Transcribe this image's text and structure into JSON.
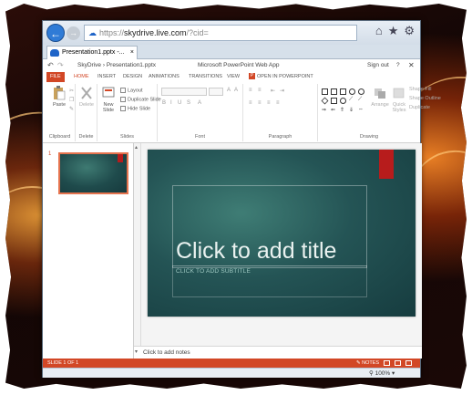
{
  "browser": {
    "address_scheme": "https://",
    "address_host": "skydrive.live.com",
    "address_rest": "/?cid=",
    "tab_title": "Presentation1.pptx -..."
  },
  "appbar": {
    "crumb_root": "SkyDrive",
    "crumb_sep": "›",
    "crumb_file": "Presentation1.pptx",
    "app_title": "Microsoft PowerPoint Web App",
    "sign_out": "Sign out",
    "help": "?",
    "close": "✕"
  },
  "ribbon_tabs": [
    "FILE",
    "HOME",
    "INSERT",
    "DESIGN",
    "ANIMATIONS",
    "TRANSITIONS",
    "VIEW",
    "OPEN IN POWERPOINT"
  ],
  "active_tab": "HOME",
  "ribbon": {
    "clipboard": {
      "paste": "Paste",
      "label": "Clipboard"
    },
    "delete": {
      "button": "Delete",
      "label": "Delete"
    },
    "slides": {
      "new_slide_line1": "New",
      "new_slide_line2": "Slide",
      "layout": "Layout",
      "duplicate": "Duplicate Slide",
      "hide": "Hide Slide",
      "label": "Slides"
    },
    "font": {
      "label": "Font"
    },
    "paragraph": {
      "label": "Paragraph"
    },
    "drawing": {
      "arrange_line1": "Arrange",
      "quick_styles_line1": "Quick",
      "quick_styles_line2": "Styles",
      "shape_fill": "Shape Fill",
      "shape_outline": "Shape Outline",
      "duplicate": "Duplicate",
      "label": "Drawing"
    }
  },
  "thumbnails": [
    {
      "number": "1"
    }
  ],
  "slide": {
    "title_placeholder": "Click to add title",
    "subtitle_placeholder": "CLICK TO ADD SUBTITLE"
  },
  "notes_placeholder": "Click to add notes",
  "status": {
    "slide_count": "SLIDE 1 OF 1",
    "notes": "NOTES"
  },
  "zoom": "100%",
  "colors": {
    "accent": "#d24726",
    "slide_background": "#245455",
    "slide_accent": "#b71c1c"
  }
}
